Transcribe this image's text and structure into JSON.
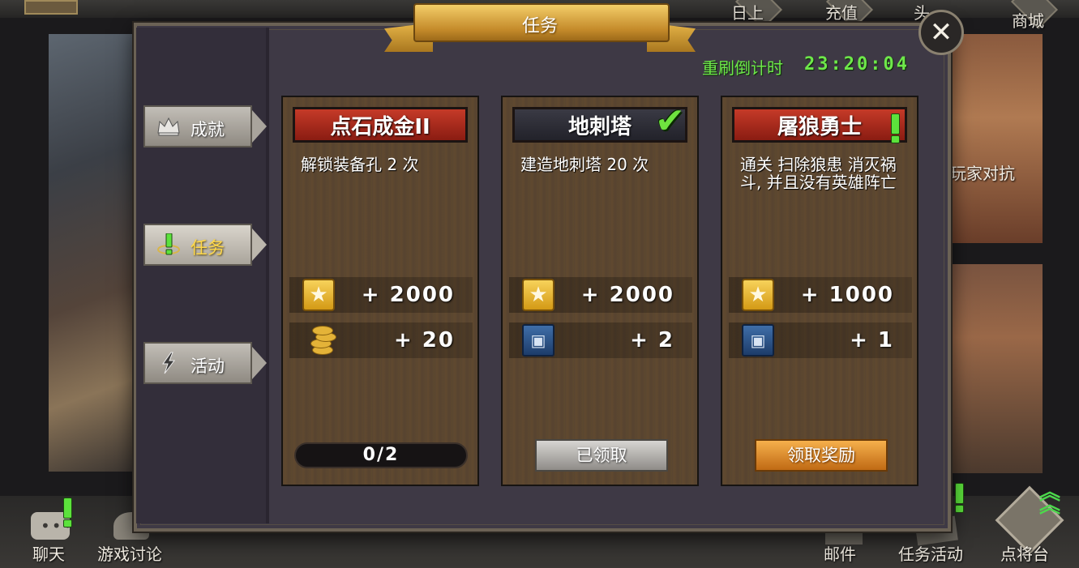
{
  "top_nav": {
    "item_1": "日上",
    "item_2": "充值",
    "item_3": "头",
    "shop": "商城"
  },
  "background": {
    "pvp_label": "玩家对抗"
  },
  "bottom_nav": {
    "chat": "聊天",
    "forum": "游戏讨论",
    "mail": "邮件",
    "task_activity": "任务活动",
    "general": "点将台"
  },
  "modal": {
    "title": "任务",
    "refresh_label": "重刷倒计时",
    "refresh_timer": "23:20:04",
    "close_icon": "close-x-icon"
  },
  "side_tabs": [
    {
      "label": "成就",
      "icon": "crown-icon",
      "active": false
    },
    {
      "label": "任务",
      "icon": "quest-icon",
      "active": true
    },
    {
      "label": "活动",
      "icon": "lightning-icon",
      "active": false
    }
  ],
  "quests": [
    {
      "title": "点石成金II",
      "header_style": "red",
      "description": "解锁装备孔 2 次",
      "rewards": [
        {
          "icon": "star-icon",
          "amount": "+ 2000"
        },
        {
          "icon": "coin-icon",
          "amount": "+ 20"
        }
      ],
      "progress": "0/2"
    },
    {
      "title": "地刺塔",
      "header_style": "dark",
      "completed": true,
      "description": "建造地刺塔 20 次",
      "rewards": [
        {
          "icon": "star-icon",
          "amount": "+ 2000"
        },
        {
          "icon": "card-icon",
          "amount": "+ 2"
        }
      ],
      "button": "已领取"
    },
    {
      "title": "屠狼勇士",
      "header_style": "red",
      "description": "通关 扫除狼患 消灭祸斗, 并且没有英雄阵亡",
      "rewards": [
        {
          "icon": "star-icon",
          "amount": "+ 1000"
        },
        {
          "icon": "card-icon",
          "amount": "+ 1"
        }
      ],
      "button": "领取奖励"
    }
  ],
  "colors": {
    "timer_green": "#6ee84a",
    "header_red": "#c53a28",
    "claim_orange": "#f6b04c",
    "active_tab_yellow": "#ffd84a"
  }
}
